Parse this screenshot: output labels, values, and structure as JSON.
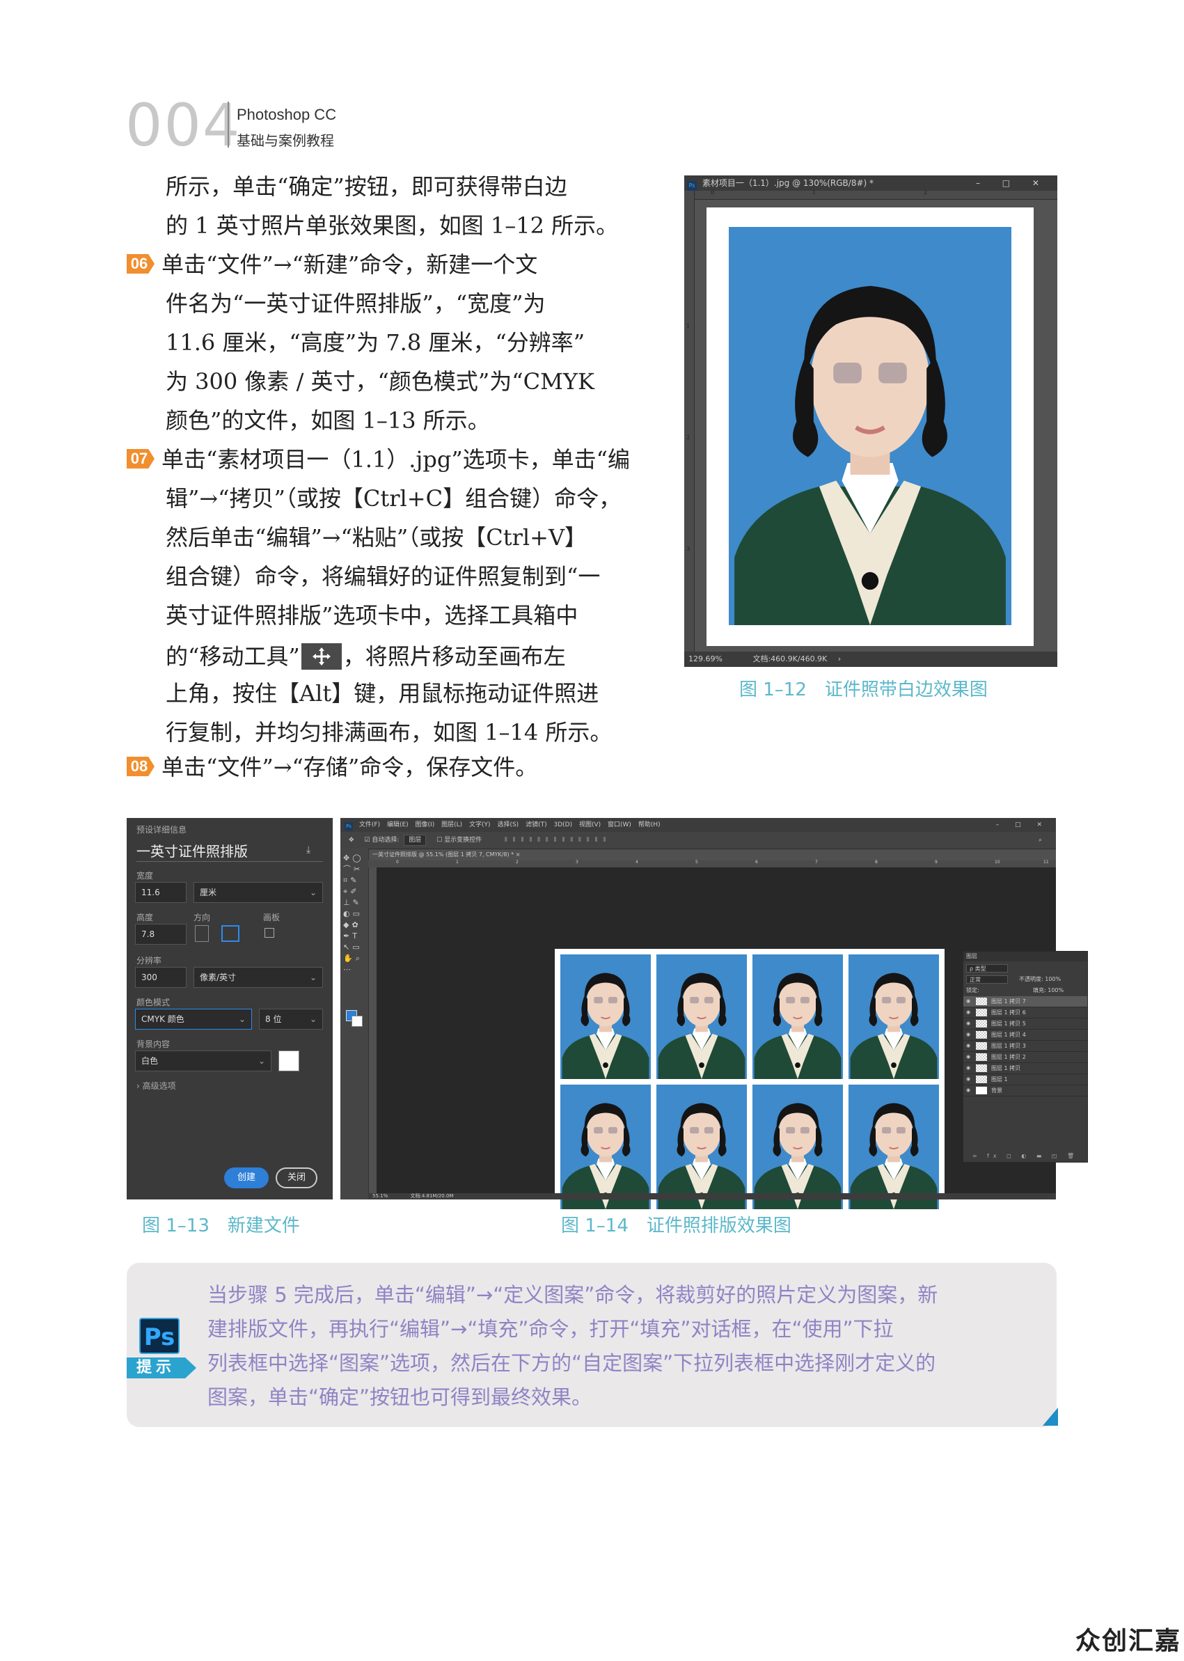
{
  "header": {
    "page_number": "004",
    "book_title": "Photoshop CC",
    "book_subtitle": "基础与案例教程"
  },
  "body_lines": [
    "所示，单击“确定”按钮，即可获得带白边",
    "的 1 英寸照片单张效果图，如图 1–12 所示。",
    "单击“文件”→“新建”命令，新建一个文",
    "件名为“一英寸证件照排版”，“宽度”为",
    "11.6 厘米，“高度”为 7.8 厘米，“分辨率”",
    "为 300 像素 / 英寸，“颜色模式”为“CMYK",
    "颜色”的文件，如图 1–13 所示。",
    "单击“素材项目一（1.1）.jpg”选项卡，单击“编",
    "辑”→“拷贝”（或按【Ctrl+C】组合键）命令，",
    "然后单击“编辑”→“粘贴”（或按【Ctrl+V】",
    "组合键）命令，将编辑好的证件照复制到“一",
    "英寸证件照排版”选项卡中，选择工具箱中",
    "的“移动工具”",
    "，将照片移动至画布左",
    "上角，按住【Alt】键，用鼠标拖动证件照进",
    "行复制，并均匀排满画布，如图 1–14 所示。",
    "单击“文件”→“存储”命令，保存文件。"
  ],
  "steps": [
    "06",
    "07",
    "08"
  ],
  "fig12": {
    "window_title": "素材项目一（1.1）.jpg @ 130%(RGB/8#) *",
    "ruler_marks": [
      "0",
      "1",
      "2",
      "1",
      "2",
      "3"
    ],
    "zoom": "129.69%",
    "doc_size": "文档:460.9K/460.9K",
    "caption": "图 1–12　证件照带白边效果图"
  },
  "fig13": {
    "preset_label": "预设详细信息",
    "doc_name": "一英寸证件照排版",
    "width_label": "宽度",
    "width_value": "11.6",
    "width_unit": "厘米",
    "height_label": "高度",
    "height_value": "7.8",
    "orient_label": "方向",
    "artboard_label": "画板",
    "resolution_label": "分辨率",
    "resolution_value": "300",
    "resolution_unit": "像素/英寸",
    "color_mode_label": "颜色模式",
    "color_mode_value": "CMYK 颜色",
    "bit_depth": "8 位",
    "bg_label": "背景内容",
    "bg_value": "白色",
    "advanced": "高级选项",
    "create": "创建",
    "close": "关闭",
    "caption": "图 1–13　新建文件"
  },
  "fig14": {
    "menu": [
      "文件(F)",
      "编辑(E)",
      "图像(I)",
      "图层(L)",
      "文字(Y)",
      "选择(S)",
      "滤镜(T)",
      "3D(D)",
      "视图(V)",
      "窗口(W)",
      "帮助(H)"
    ],
    "auto_select": "自动选择:",
    "auto_select_value": "图层",
    "show_transform": "显示变换控件",
    "tab": "一英寸证件照排版 @ 55.1% (图层 1 拷贝 7, CMYK/8) *",
    "ruler_marks": [
      "0",
      "1",
      "2",
      "3",
      "4",
      "5",
      "6",
      "7",
      "8",
      "9",
      "10",
      "11"
    ],
    "layers_title": "图层",
    "kind": "类型",
    "blend": "正常",
    "opacity_label": "不透明度:",
    "opacity": "100%",
    "lock_label": "锁定:",
    "fill_label": "填充:",
    "fill": "100%",
    "layers": [
      "图层 1 拷贝 7",
      "图层 1 拷贝 6",
      "图层 1 拷贝 5",
      "图层 1 拷贝 4",
      "图层 1 拷贝 3",
      "图层 1 拷贝 2",
      "图层 1 拷贝",
      "图层 1",
      "背景"
    ],
    "zoom": "55.1%",
    "doc_size": "文档:4.81M/20.0M",
    "caption": "图 1–14　证件照排版效果图",
    "photo_count": 8
  },
  "tip": {
    "badge": "Ps",
    "label": "提示",
    "lines": [
      "当步骤 5 完成后，单击“编辑”→“定义图案”命令，将裁剪好的照片定义为图案，新",
      "建排版文件，再执行“编辑”→“填充”命令，打开“填充”对话框，在“使用”下拉",
      "列表框中选择“图案”选项，然后在下方的“自定图案”下拉列表框中选择刚才定义的",
      "图案，单击“确定”按钮也可得到最终效果。"
    ]
  },
  "watermark": "众创汇嘉",
  "colors": {
    "step_orange": "#f18e2e",
    "caption_teal": "#5bb8c9",
    "tip_text": "#8e84c4",
    "photo_blue": "#3e8acb",
    "sweater_green": "#1f4a37"
  }
}
